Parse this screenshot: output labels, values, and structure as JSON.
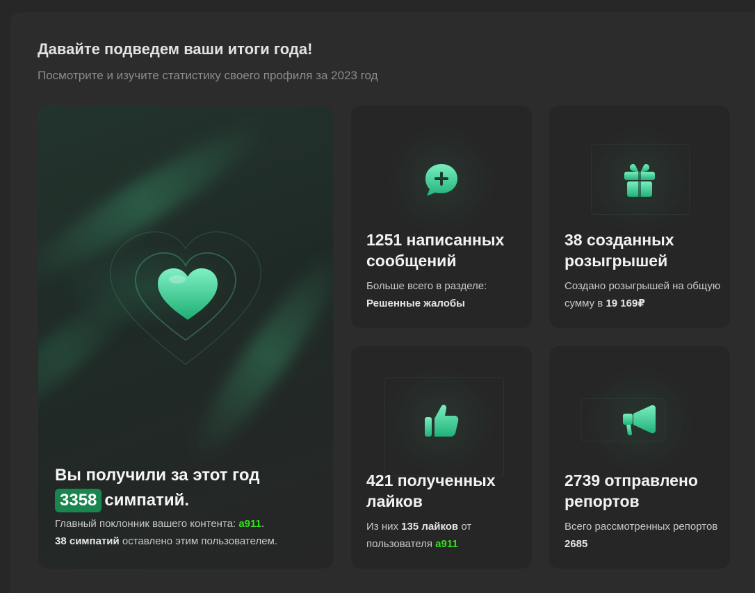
{
  "header": {
    "title": "Давайте подведем ваши итоги года!",
    "subtitle": "Посмотрите и изучите статистику своего профиля за 2023 год"
  },
  "main_card": {
    "icon": "heart-icon",
    "title_prefix": "Вы получили за этот год",
    "count": "3358",
    "title_suffix": "симпатий.",
    "desc_prefix": "Главный поклонник вашего контента:",
    "fan": "a911",
    "desc_bold": "38 симпатий",
    "desc_suffix": "оставлено этим пользователем."
  },
  "cards": {
    "messages": {
      "icon": "chat-plus-icon",
      "title": "1251 написанных сообщений",
      "desc": "Больше всего в разделе:",
      "desc_bold": "Решенные жалобы"
    },
    "giveaways": {
      "icon": "gift-icon",
      "title": "38 созданных розыгрышей",
      "desc": "Создано розыгрышей на общую сумму в",
      "desc_bold": "19 169₽"
    },
    "likes": {
      "icon": "thumbs-up-icon",
      "title": "421 полученных лайков",
      "desc_prefix": "Из них",
      "desc_bold": "135 лайков",
      "desc_mid": "от пользователя",
      "user": "a911"
    },
    "reports": {
      "icon": "megaphone-icon",
      "title": "2739 отправлено репортов",
      "desc": "Всего рассмотренных репортов",
      "desc_bold": "2685"
    }
  },
  "colors": {
    "accent": "#19864f",
    "icon_green": "#3fd49a",
    "highlight": "#34e01c",
    "background": "#272727"
  }
}
